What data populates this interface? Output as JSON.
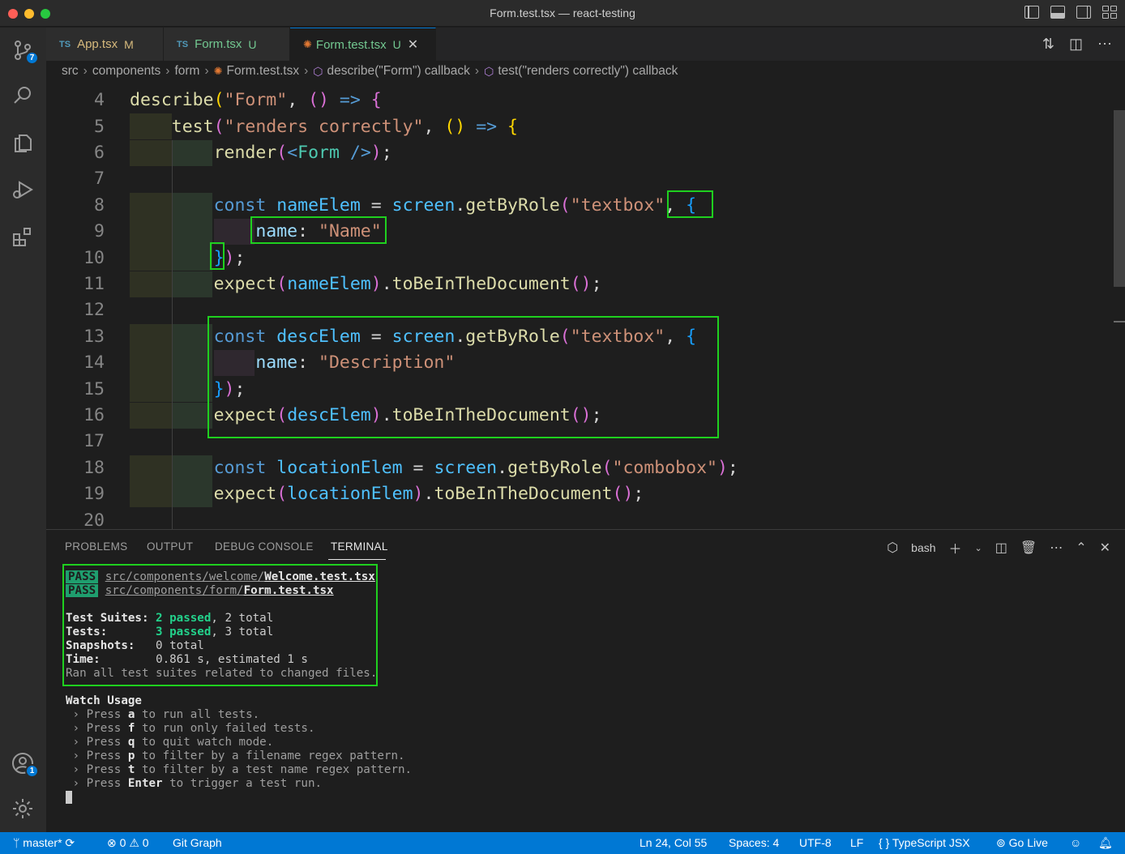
{
  "window": {
    "title": "Form.test.tsx — react-testing"
  },
  "activity": {
    "scm_badge": "7",
    "accounts_badge": "1"
  },
  "tabs": [
    {
      "label": "App.tsx",
      "lang": "TS",
      "status": "M"
    },
    {
      "label": "Form.tsx",
      "lang": "TS",
      "status": "U"
    },
    {
      "label": "Form.test.tsx",
      "status": "U",
      "close": "✕"
    }
  ],
  "breadcrumb": {
    "items": [
      "src",
      "components",
      "form",
      "Form.test.tsx",
      "describe(\"Form\") callback",
      "test(\"renders correctly\") callback"
    ]
  },
  "editor": {
    "line_numbers": [
      "4",
      "5",
      "6",
      "7",
      "8",
      "9",
      "10",
      "11",
      "12",
      "13",
      "14",
      "15",
      "16",
      "17",
      "18",
      "19",
      "20"
    ]
  },
  "panel": {
    "tabs": [
      "PROBLEMS",
      "OUTPUT",
      "DEBUG CONSOLE",
      "TERMINAL"
    ],
    "shell": "bash"
  },
  "terminal": {
    "pass_label": "PASS",
    "file1_dir": "src/components/welcome/",
    "file1_name": "Welcome.test.tsx",
    "file2_dir": "src/components/form/",
    "file2_name": "Form.test.tsx",
    "suites_label": "Test Suites:",
    "suites_passed": "2 passed",
    "suites_total": ", 2 total",
    "tests_label": "Tests:",
    "tests_passed": "3 passed",
    "tests_total": ", 3 total",
    "snapshots_label": "Snapshots:",
    "snapshots_value": "0 total",
    "time_label": "Time:",
    "time_value": "0.861 s, estimated 1 s",
    "ran_all": "Ran all test suites related to changed files.",
    "watch_usage": "Watch Usage",
    "usage": [
      {
        "pre": " › Press ",
        "key": "a",
        "post": " to run all tests."
      },
      {
        "pre": " › Press ",
        "key": "f",
        "post": " to run only failed tests."
      },
      {
        "pre": " › Press ",
        "key": "q",
        "post": " to quit watch mode."
      },
      {
        "pre": " › Press ",
        "key": "p",
        "post": " to filter by a filename regex pattern."
      },
      {
        "pre": " › Press ",
        "key": "t",
        "post": " to filter by a test name regex pattern."
      },
      {
        "pre": " › Press ",
        "key": "Enter",
        "post": " to trigger a test run."
      }
    ]
  },
  "statusbar": {
    "branch": "master*",
    "errors": "0",
    "warnings": "0",
    "git_graph": "Git Graph",
    "position": "Ln 24, Col 55",
    "spaces": "Spaces: 4",
    "encoding": "UTF-8",
    "eol": "LF",
    "language": "TypeScript JSX",
    "go_live": "Go Live"
  },
  "colors": {
    "accent": "#0078d4",
    "highlight_box": "#1fd01f",
    "pass_bg": "#1f9e6e"
  }
}
